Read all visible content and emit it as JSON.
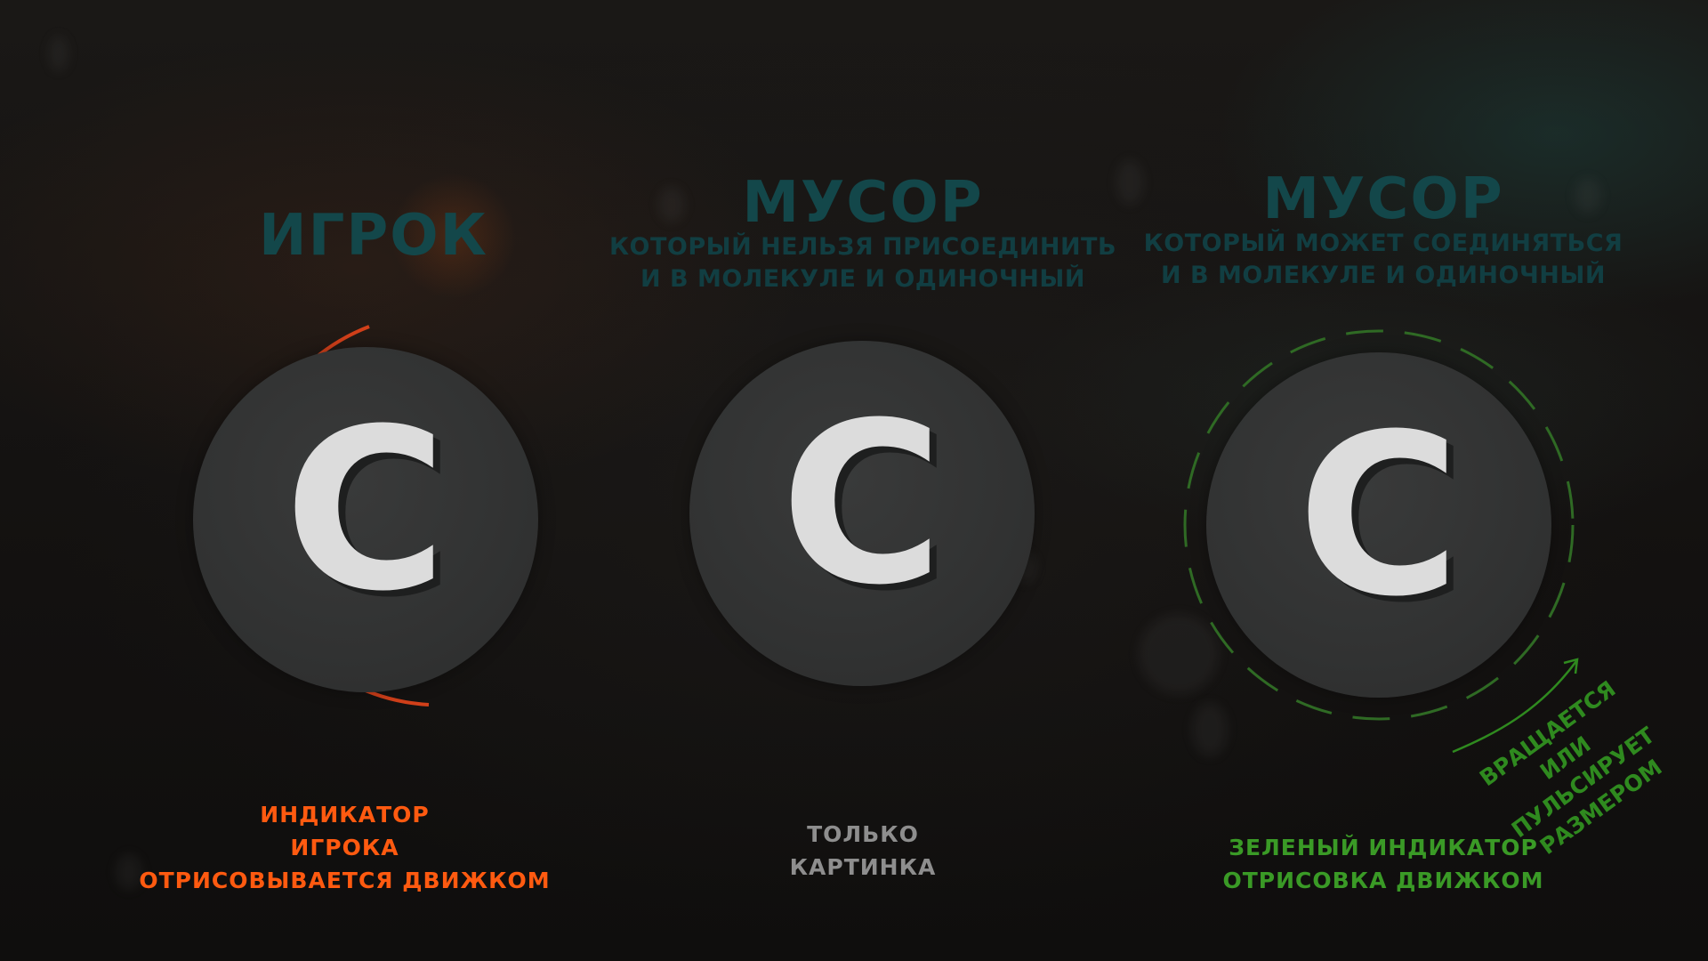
{
  "titles": {
    "player": "ИГРОК",
    "debris_fixed": "МУСОР",
    "debris_fixed_sub1": "КОТОРЫЙ НЕЛЬЗЯ ПРИСОЕДИНИТЬ",
    "debris_fixed_sub2": "И В МОЛЕКУЛЕ И ОДИНОЧНЫЙ",
    "debris_joinable": "МУСОР",
    "debris_joinable_sub1": "КОТОРЫЙ МОЖЕТ СОЕДИНЯТЬСЯ",
    "debris_joinable_sub2": "И В МОЛЕКУЛЕ И ОДИНОЧНЫЙ"
  },
  "tokens": [
    {
      "letter": "C"
    },
    {
      "letter": "C"
    },
    {
      "letter": "C"
    }
  ],
  "captions": {
    "player": [
      "ИНДИКАТОР",
      "ИГРОКА",
      "ОТРИСОВЫВАЕТСЯ ДВИЖКОМ"
    ],
    "debris_fixed": [
      "ТОЛЬКО",
      "КАРТИНКА"
    ],
    "debris_joinable": [
      "ЗЕЛЕНЫЙ ИНДИКАТОР",
      "ОТРИСОВКА ДВИЖКОМ"
    ]
  },
  "note": [
    "ВРАЩАЕТСЯ",
    "ИЛИ ПУЛЬСИРУЕТ",
    "РАЗМЕРОМ"
  ],
  "colors": {
    "title": "#13474a",
    "player_indicator": "#d2401a",
    "joinable_indicator": "#2f6a24",
    "token_bg": "#333434",
    "letter": "#dcdcdc"
  }
}
